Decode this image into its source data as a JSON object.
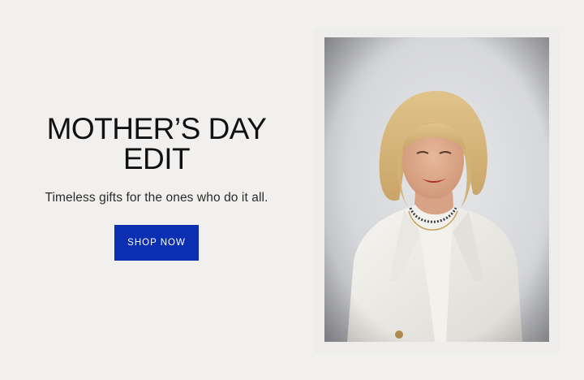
{
  "promo": {
    "headline_line1": "MOTHER’S DAY",
    "headline_line2": "EDIT",
    "subheadline": "Timeless gifts for the ones who do it all.",
    "cta_label": "SHOP NOW"
  },
  "colors": {
    "background": "#f1f0ee",
    "cta_background": "#0a2fb3",
    "cta_text": "#ffffff",
    "headline": "#111111"
  }
}
